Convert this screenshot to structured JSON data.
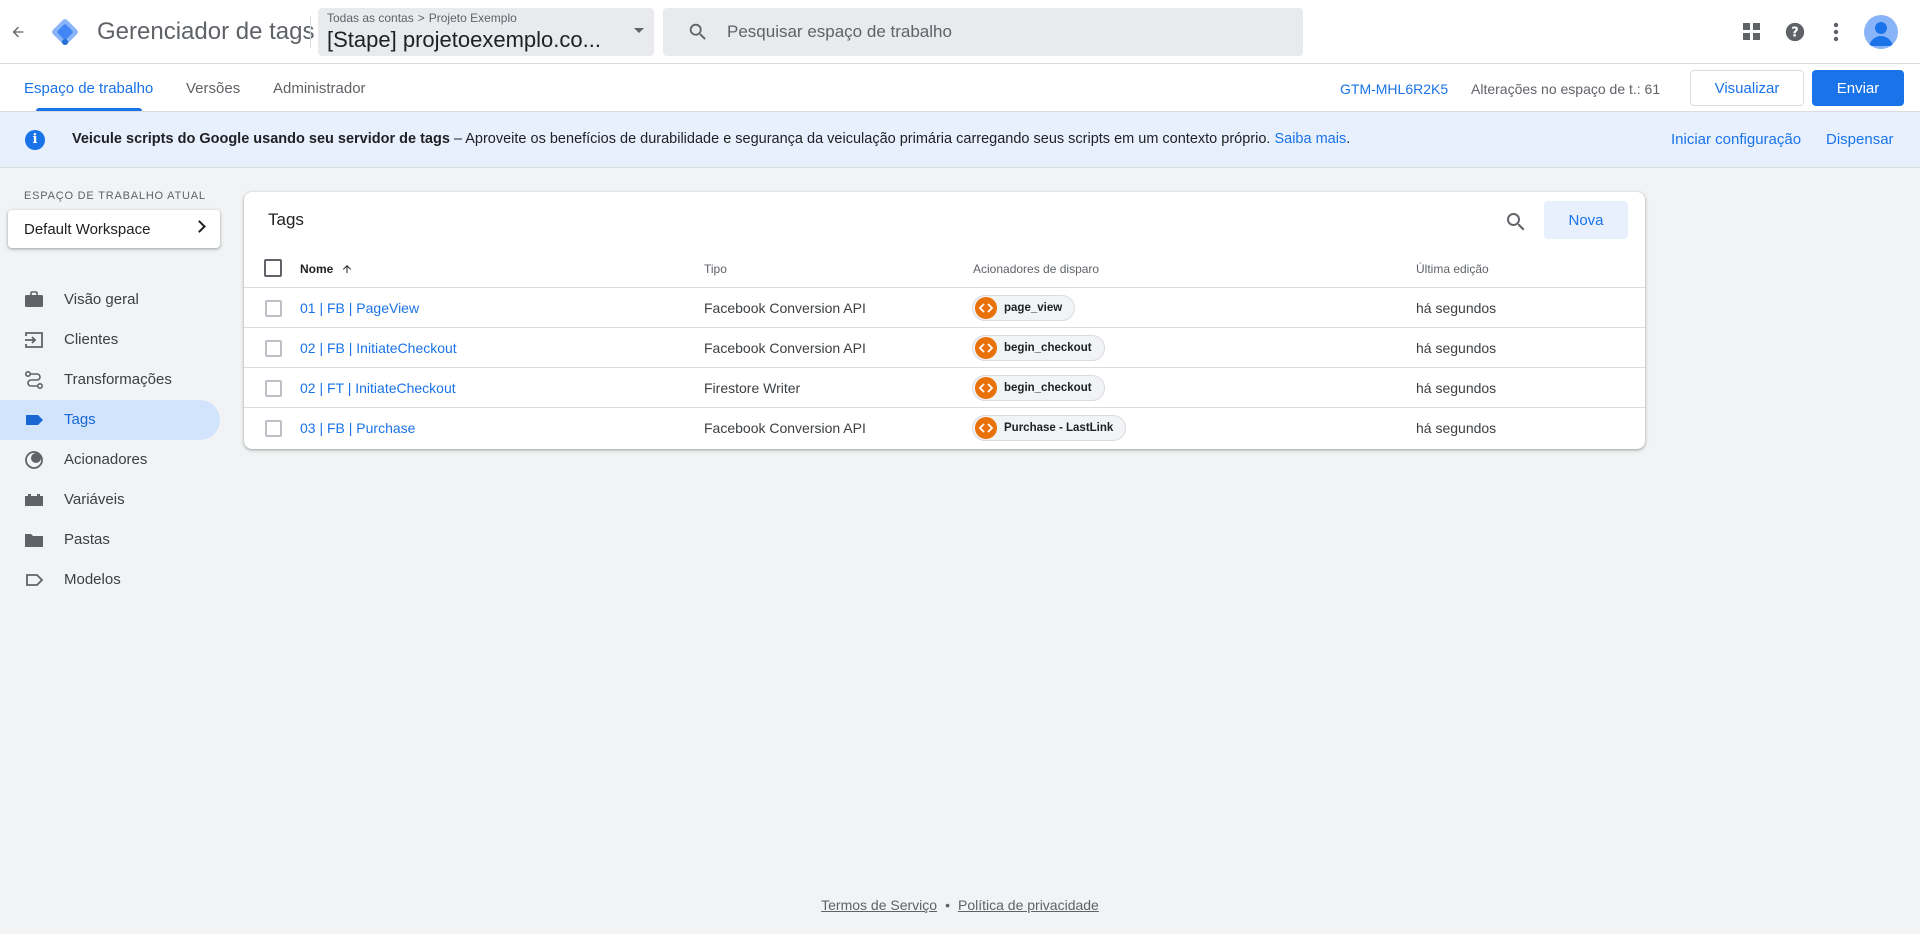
{
  "header": {
    "product_name": "Gerenciador de tags",
    "breadcrumb": {
      "root": "Todas as contas",
      "sep": ">",
      "account": "Projeto Exemplo"
    },
    "container_name": "[Stape] projetoexemplo.co...",
    "search_placeholder": "Pesquisar espaço de trabalho",
    "icons": [
      "arrow-back-icon",
      "apps-grid-icon",
      "help-icon",
      "more-vert-icon",
      "account-avatar-icon"
    ]
  },
  "subnav": {
    "tabs": [
      {
        "label": "Espaço de trabalho",
        "active": true
      },
      {
        "label": "Versões",
        "active": false
      },
      {
        "label": "Administrador",
        "active": false
      }
    ],
    "container_id": "GTM-MHL6R2K5",
    "changes_text": "Alterações no espaço de t.: 61",
    "preview_label": "Visualizar",
    "submit_label": "Enviar"
  },
  "banner": {
    "title": "Veicule scripts do Google usando seu servidor de tags",
    "body": " – Aproveite os benefícios de durabilidade e segurança da veiculação primária carregando seus scripts em um contexto próprio. ",
    "learn_more": "Saiba mais",
    "period": ".",
    "action_primary": "Iniciar configuração",
    "action_dismiss": "Dispensar"
  },
  "sidebar": {
    "workspace_label": "ESPAÇO DE TRABALHO ATUAL",
    "workspace_name": "Default Workspace",
    "items": [
      {
        "label": "Visão geral",
        "icon": "briefcase-icon"
      },
      {
        "label": "Clientes",
        "icon": "client-login-icon"
      },
      {
        "label": "Transformações",
        "icon": "transform-route-icon"
      },
      {
        "label": "Tags",
        "icon": "tag-icon",
        "active": true
      },
      {
        "label": "Acionadores",
        "icon": "trigger-icon"
      },
      {
        "label": "Variáveis",
        "icon": "variables-icon"
      },
      {
        "label": "Pastas",
        "icon": "folder-icon"
      },
      {
        "label": "Modelos",
        "icon": "template-label-icon"
      }
    ]
  },
  "tags_table": {
    "title": "Tags",
    "new_label": "Nova",
    "columns": {
      "name": "Nome",
      "type": "Tipo",
      "triggers": "Acionadores de disparo",
      "last_edit": "Última edição"
    },
    "rows": [
      {
        "name": "01 | FB | PageView",
        "type": "Facebook Conversion API",
        "trigger": "page_view",
        "last_edit": "há segundos"
      },
      {
        "name": "02 | FB | InitiateCheckout",
        "type": "Facebook Conversion API",
        "trigger": "begin_checkout",
        "last_edit": "há segundos"
      },
      {
        "name": "02 | FT | InitiateCheckout",
        "type": "Firestore Writer",
        "trigger": "begin_checkout",
        "last_edit": "há segundos"
      },
      {
        "name": "03 | FB | Purchase",
        "type": "Facebook Conversion API",
        "trigger": "Purchase - LastLink",
        "last_edit": "há segundos"
      }
    ]
  },
  "footer": {
    "terms": "Termos de Serviço",
    "dot": "•",
    "privacy": "Política de privacidade"
  },
  "colors": {
    "accent": "#1a73e8",
    "active_nav_bg": "#d2e3fc",
    "banner_bg": "#e8f0fe",
    "trigger_icon": "#e8710a",
    "page_bg": "#f1f3f4"
  }
}
